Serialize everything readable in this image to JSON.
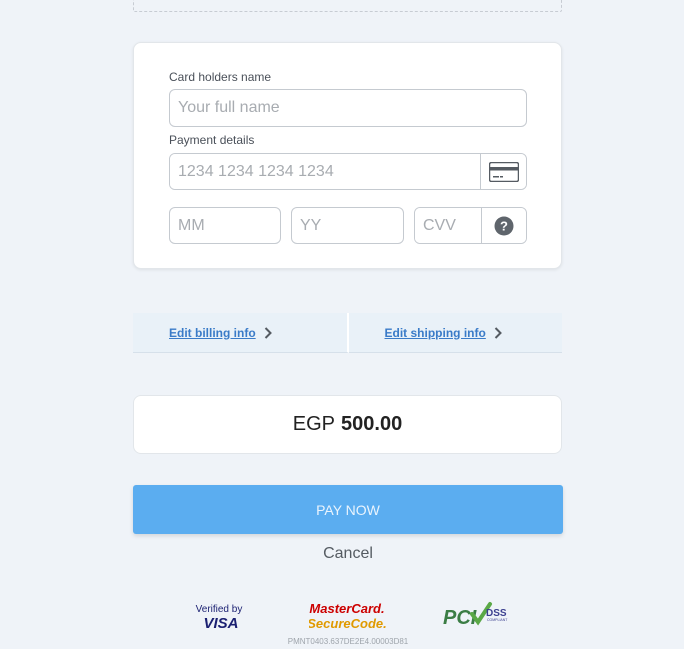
{
  "form": {
    "name_label": "Card holders name",
    "name_placeholder": "Your full name",
    "payment_label": "Payment details",
    "card_placeholder": "1234 1234 1234 1234",
    "mm_placeholder": "MM",
    "yy_placeholder": "YY",
    "cvv_placeholder": "CVV",
    "card_icon": "credit-card-icon",
    "help_icon": "question-circle-icon"
  },
  "edit": {
    "billing_label": "Edit billing info",
    "shipping_label": "Edit shipping info",
    "chevron": "›"
  },
  "amount": {
    "currency": "EGP",
    "value": "500.00"
  },
  "actions": {
    "pay_label": "PAY NOW",
    "cancel_label": "Cancel"
  },
  "logos": {
    "visa_line1": "Verified by",
    "visa_line2": "VISA",
    "mc_line1": "MasterCard.",
    "mc_line2": "SecureCode.",
    "pci_main": "PCI",
    "pci_dss": "DSS",
    "pci_compliant": "COMPLIANT"
  },
  "footer": {
    "code": "PMNT0403.637DE2E4.00003D81"
  },
  "colors": {
    "accent": "#5badf0",
    "link": "#3a7bc8",
    "background": "#eff3f8"
  }
}
